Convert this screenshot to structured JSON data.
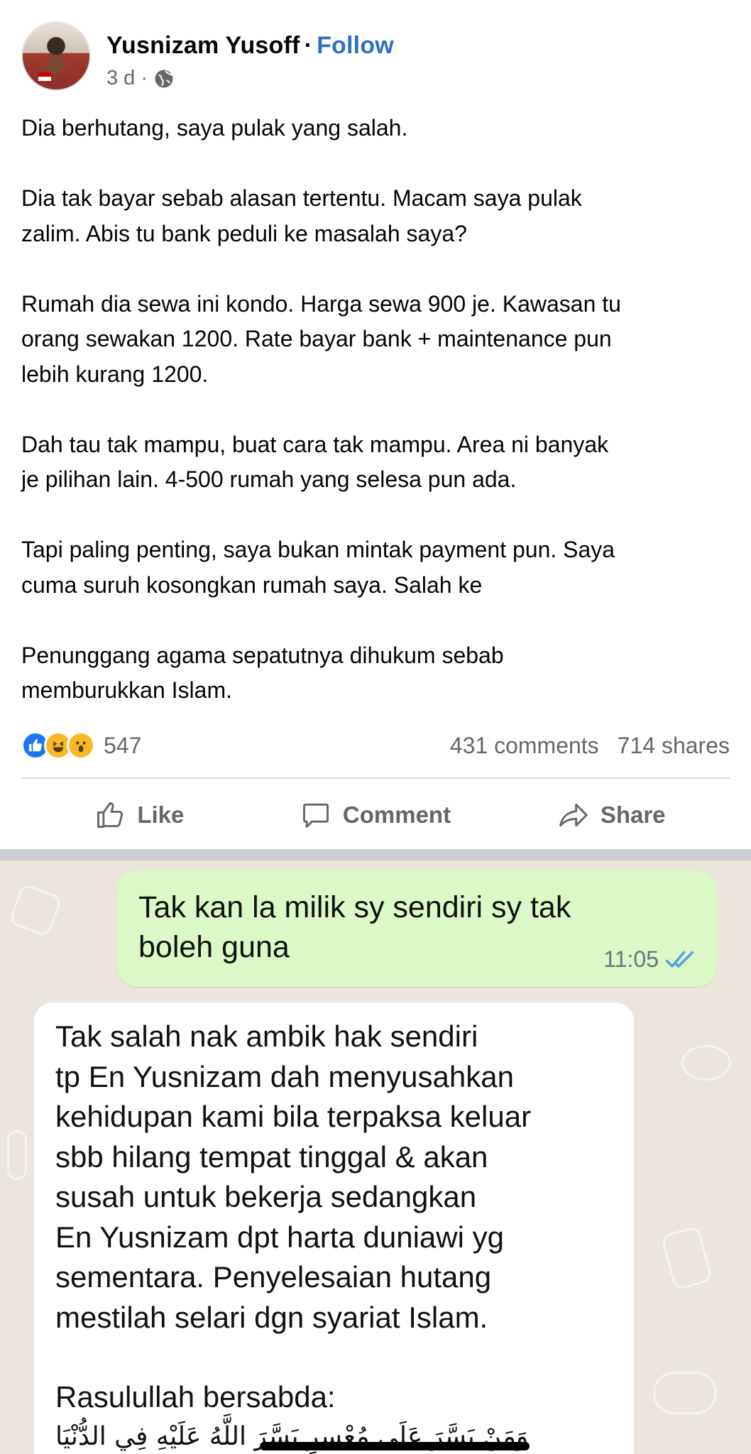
{
  "post": {
    "author": "Yusnizam Yusoff",
    "separator": "·",
    "follow_label": "Follow",
    "time_ago": "3 d ·",
    "paragraphs": [
      "Dia berhutang, saya pulak yang salah.",
      "Dia tak bayar sebab alasan tertentu. Macam saya pulak\nzalim. Abis tu bank peduli ke masalah saya?",
      "Rumah dia sewa ini kondo. Harga sewa 900 je. Kawasan tu\norang sewakan 1200. Rate bayar bank + maintenance pun\nlebih kurang 1200.",
      "Dah tau tak mampu, buat cara tak mampu. Area ni banyak\nje pilihan lain. 4-500 rumah yang selesa pun ada.",
      "Tapi paling penting, saya bukan mintak payment pun. Saya\ncuma suruh kosongkan rumah saya. Salah ke",
      "Penunggang agama sepatutnya dihukum sebab\nmemburukkan Islam."
    ],
    "reaction_count": "547",
    "comments": "431 comments",
    "shares": "714 shares",
    "actions": {
      "like": "Like",
      "comment": "Comment",
      "share": "Share"
    },
    "icons": [
      "like-reaction-icon",
      "haha-reaction-icon",
      "wow-reaction-icon",
      "globe-icon",
      "thumbs-up-icon",
      "comment-icon",
      "share-icon"
    ]
  },
  "chat": {
    "outgoing": {
      "text": "Tak kan la milik sy sendiri sy tak boleh guna",
      "time": "11:05"
    },
    "incoming": {
      "text": "Tak salah nak ambik hak sendiri\ntp En Yusnizam dah menyusahkan\nkehidupan kami bila terpaksa keluar\nsbb hilang tempat tinggal & akan\nsusah untuk bekerja sedangkan\nEn Yusnizam dpt harta duniawi yg\nsementara. Penyelesaian hutang\nmestilah selari dgn syariat Islam.",
      "quote_intro": "Rasulullah bersabda:",
      "arabic": "وَمَنْ يَسَّرَ عَلَى مُعْسِرٍ يَسَّرَ اللَّهُ عَلَيْهِ فِي الدُّنْيَا"
    }
  },
  "colors": {
    "link": "#2f6fc6",
    "outgoing_bubble": "#dcf8c6",
    "chat_background": "#ece5dd",
    "read_ticks": "#4fa3e0",
    "like_blue": "#1877f2"
  }
}
